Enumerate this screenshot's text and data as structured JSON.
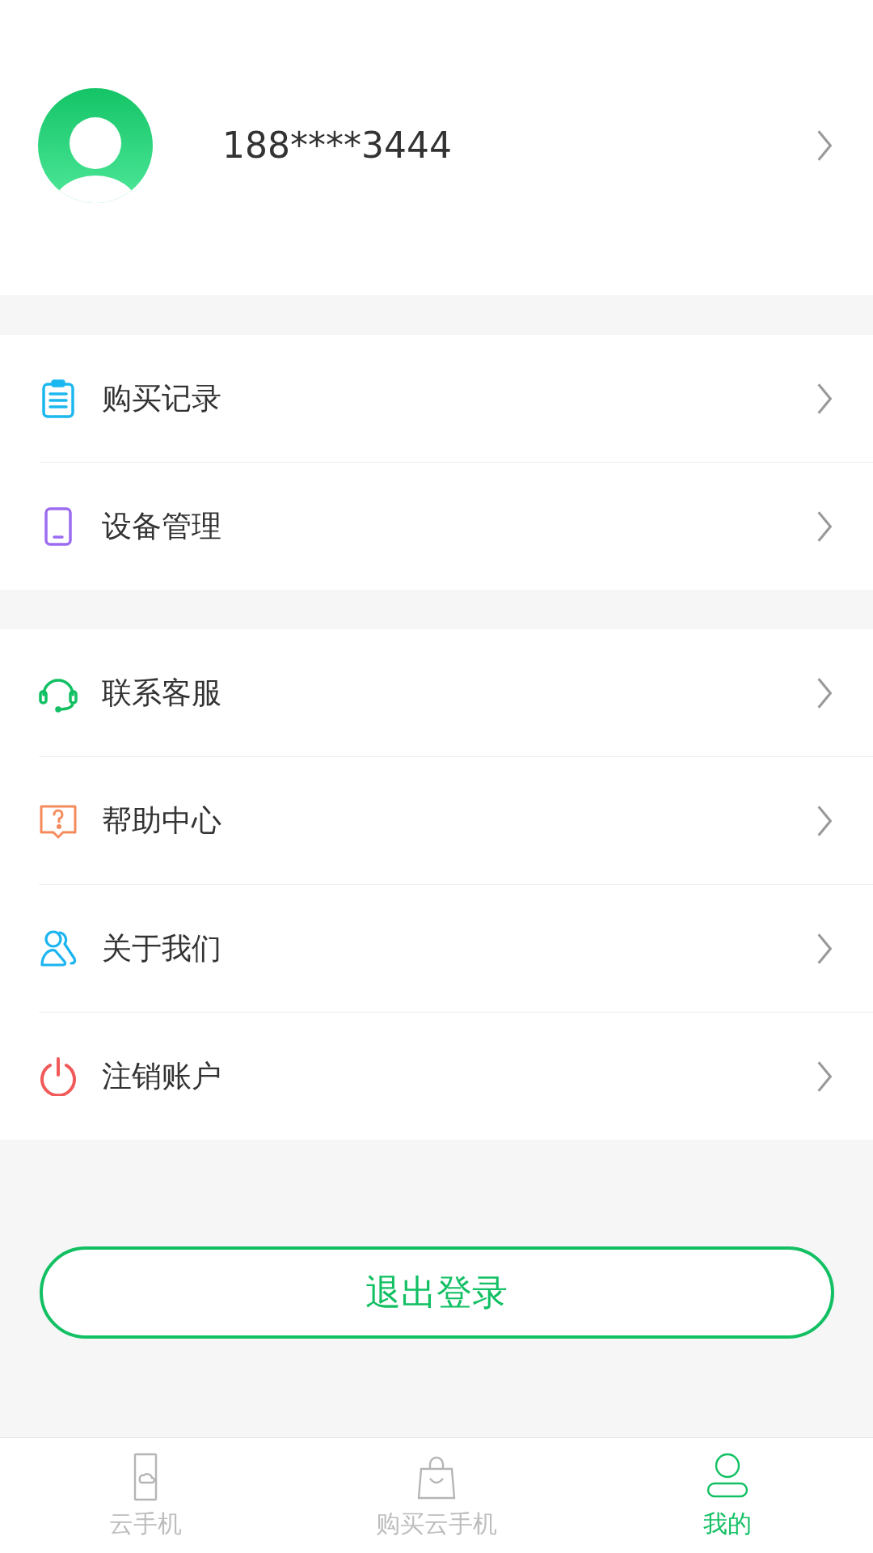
{
  "profile": {
    "phone": "188****3444"
  },
  "menu_groups": [
    {
      "items": [
        {
          "label": "购买记录",
          "kind": "records"
        },
        {
          "label": "设备管理",
          "kind": "device"
        }
      ]
    },
    {
      "items": [
        {
          "label": "联系客服",
          "kind": "service"
        },
        {
          "label": "帮助中心",
          "kind": "help"
        },
        {
          "label": "关于我们",
          "kind": "about"
        },
        {
          "label": "注销账户",
          "kind": "cancel"
        }
      ]
    }
  ],
  "logout_button": "退出登录",
  "tabs": [
    {
      "label": "云手机",
      "kind": "phone",
      "selected": false
    },
    {
      "label": "购买云手机",
      "kind": "shop",
      "selected": false
    },
    {
      "label": "我的",
      "kind": "me",
      "selected": true
    }
  ]
}
